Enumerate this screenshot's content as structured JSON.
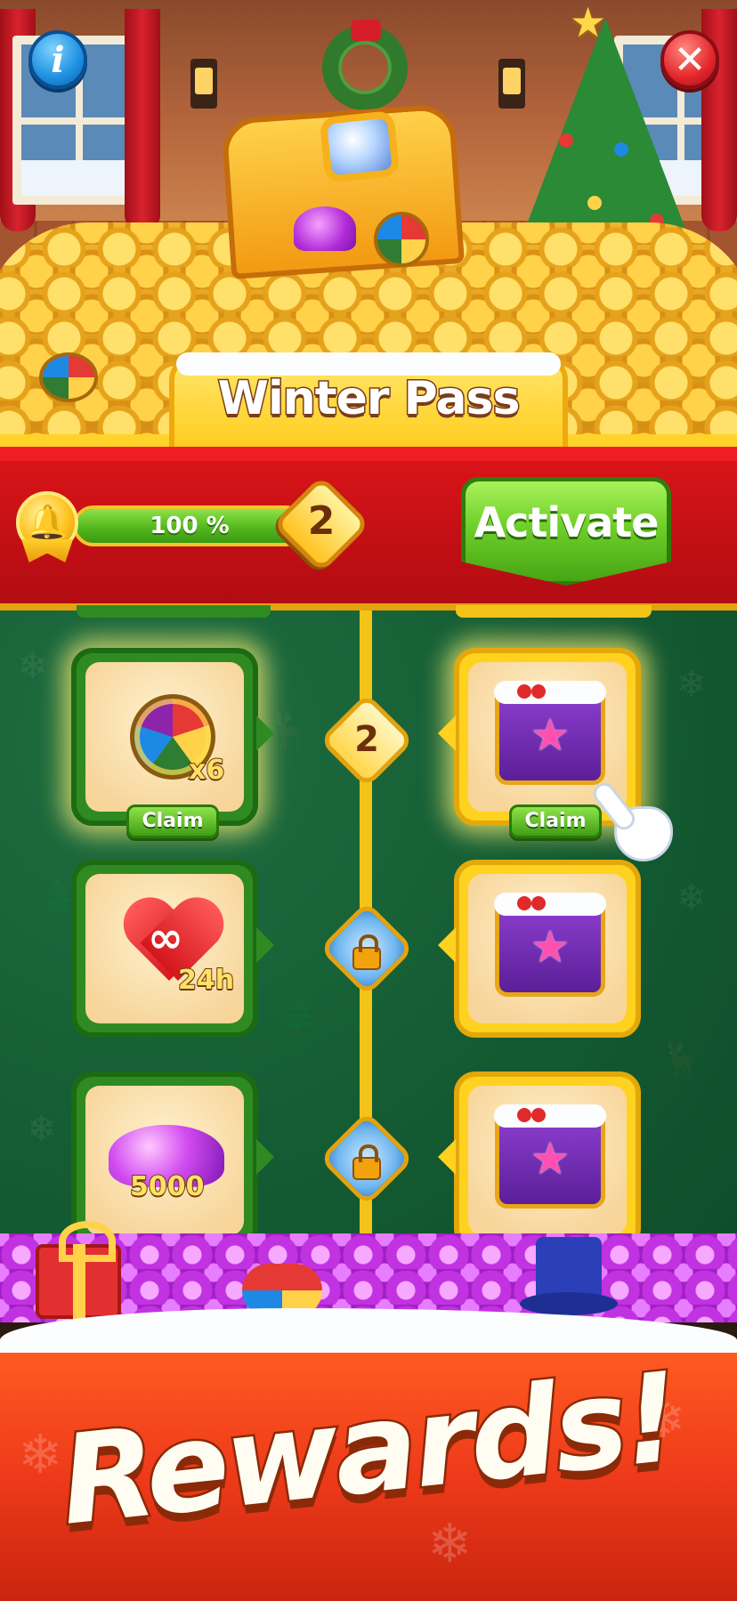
{
  "header": {
    "title": "Winter Pass",
    "info_label": "i",
    "close_label": "✕"
  },
  "pass": {
    "progress": 1.0,
    "progress_label": "100 %",
    "level": "2",
    "activate_label": "Activate"
  },
  "rewards": [
    {
      "level": "2",
      "locked": false,
      "free": {
        "icon": "color-ball-icon",
        "amount": "x6",
        "claim_label": "Claim"
      },
      "premium": {
        "icon": "treasure-chest-icon",
        "claim_label": "Claim"
      }
    },
    {
      "level": "",
      "locked": true,
      "free": {
        "icon": "infinite-lives-heart-icon",
        "amount": "24h"
      },
      "premium": {
        "icon": "treasure-chest-icon"
      }
    },
    {
      "level": "",
      "locked": true,
      "free": {
        "icon": "gems-icon",
        "amount": "5000"
      },
      "premium": {
        "icon": "treasure-chest-icon"
      }
    }
  ],
  "banner": {
    "text": "Rewards!"
  },
  "colors": {
    "header_red": "#d81418",
    "track_green": "#135a32",
    "rail_yellow": "#f2c418",
    "button_green": "#6fcf2a",
    "banner_orange": "#ee3a1a"
  }
}
